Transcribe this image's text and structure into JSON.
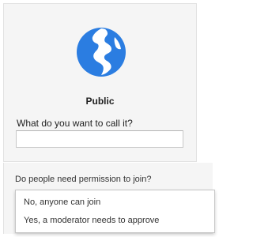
{
  "card": {
    "icon": "globe-icon",
    "title": "Public",
    "name_question": "What do you want to call it?",
    "name_value": "",
    "name_placeholder": ""
  },
  "permission": {
    "question": "Do people need permission to join?",
    "options": [
      {
        "label": "No, anyone can join"
      },
      {
        "label": "Yes, a moderator needs to approve"
      }
    ]
  },
  "colors": {
    "accent_blue": "#2b7de1",
    "card_bg": "#f5f5f5",
    "text": "#222222"
  }
}
